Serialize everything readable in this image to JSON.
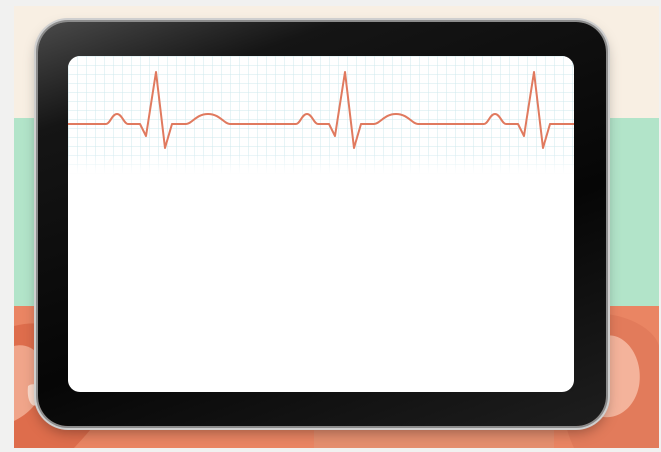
{
  "scene": {
    "colors": {
      "outer_background": "#f1f1f0",
      "top_band": "#f8efe3",
      "mint_band": "#b2e4c9",
      "coral_band": "#ea8563",
      "tablet_frame": "#0b0b0b",
      "screen": "#ffffff",
      "grid_line": "#cfe8ee",
      "ecg_trace": "#e07a5f"
    }
  },
  "tablet": {
    "screen": {
      "ecg_strip": {
        "icon": "heartbeat-ecg-trace",
        "beats_visible": 3
      }
    }
  }
}
